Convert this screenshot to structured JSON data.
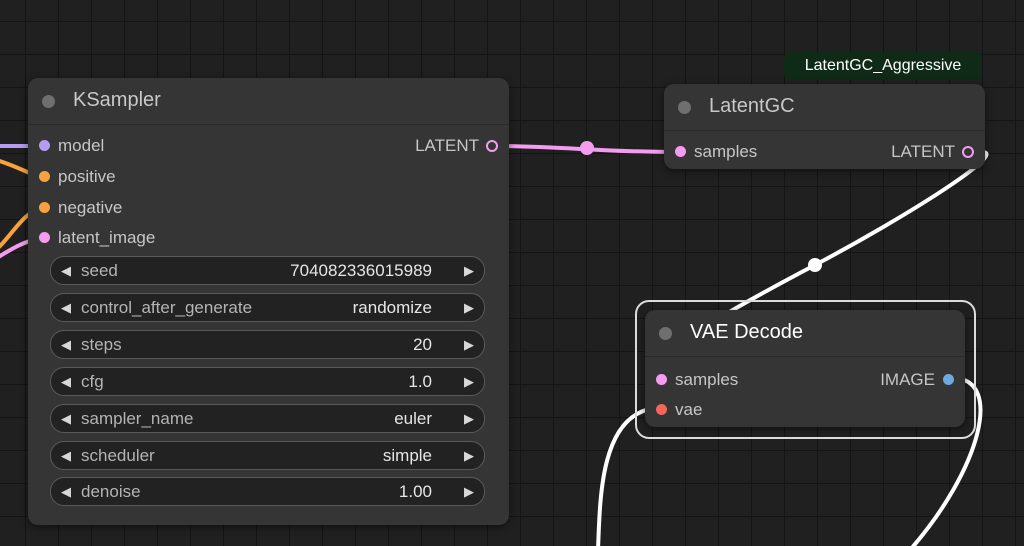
{
  "canvas": {
    "background": "#202020",
    "grid_color": "#141414"
  },
  "colors": {
    "model": "#b49cf0",
    "conditioning": "#f7a23c",
    "latent": "#f49cf0",
    "image": "#6fa8dc",
    "vae": "#f2665b",
    "link_white": "#ffffff"
  },
  "ksampler": {
    "title": "KSampler",
    "inputs": [
      {
        "label": "model",
        "color": "#b49cf0"
      },
      {
        "label": "positive",
        "color": "#f7a23c"
      },
      {
        "label": "negative",
        "color": "#f7a23c"
      },
      {
        "label": "latent_image",
        "color": "#f49cf0"
      }
    ],
    "output": {
      "label": "LATENT",
      "color": "#f49cf0"
    },
    "widgets": [
      {
        "label": "seed",
        "value": "704082336015989"
      },
      {
        "label": "control_after_generate",
        "value": "randomize"
      },
      {
        "label": "steps",
        "value": "20"
      },
      {
        "label": "cfg",
        "value": "1.0"
      },
      {
        "label": "sampler_name",
        "value": "euler"
      },
      {
        "label": "scheduler",
        "value": "simple"
      },
      {
        "label": "denoise",
        "value": "1.00"
      }
    ]
  },
  "latentgc": {
    "badge": "LatentGC_Aggressive",
    "title": "LatentGC",
    "input": {
      "label": "samples",
      "color": "#f49cf0"
    },
    "output": {
      "label": "LATENT",
      "color": "#f49cf0"
    }
  },
  "vae_decode": {
    "title": "VAE Decode",
    "inputs": [
      {
        "label": "samples",
        "color": "#f49cf0"
      },
      {
        "label": "vae",
        "color": "#f2665b"
      }
    ],
    "output": {
      "label": "IMAGE",
      "color": "#6fa8dc"
    }
  },
  "icons": {
    "arrow_left": "◀",
    "arrow_right": "▶"
  }
}
